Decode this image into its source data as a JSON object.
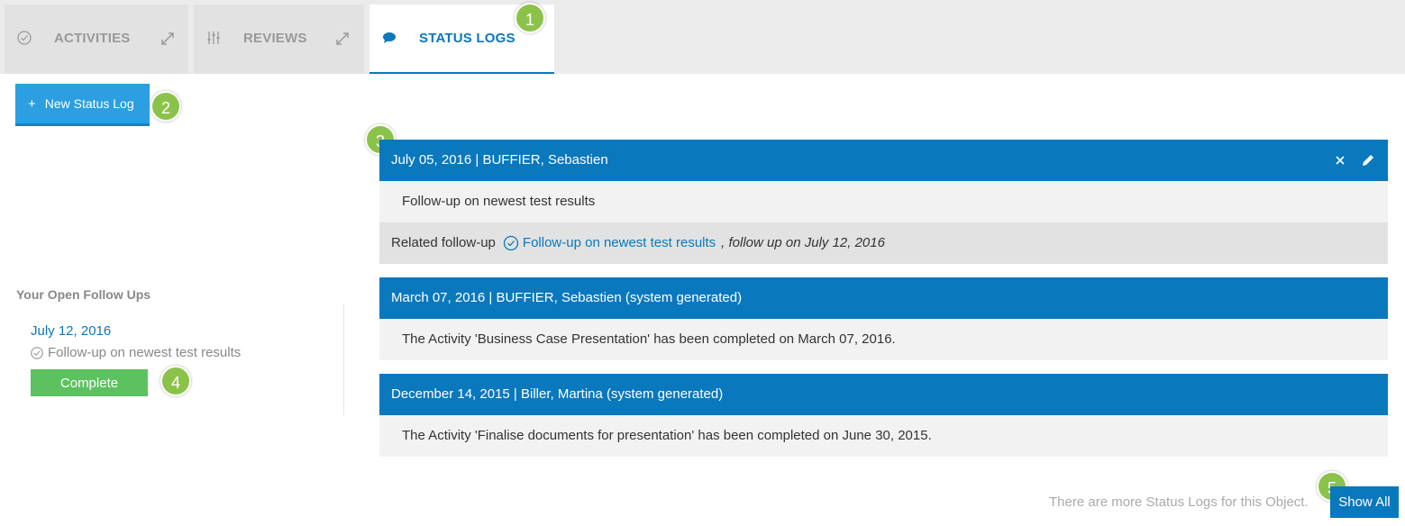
{
  "tabs": [
    {
      "label": "ACTIVITIES",
      "icon": "check-circle-icon",
      "active": false
    },
    {
      "label": "REVIEWS",
      "icon": "sliders-icon",
      "active": false
    },
    {
      "label": "STATUS LOGS",
      "icon": "speech-bubble-icon",
      "active": true
    }
  ],
  "badges": [
    "1",
    "2",
    "3",
    "4",
    "5"
  ],
  "toolbar": {
    "new_status_log_label": "New Status Log",
    "plus": "+"
  },
  "followups": {
    "title": "Your Open Follow Ups",
    "items": [
      {
        "date": "July 12, 2016",
        "label": "Follow-up on newest test results",
        "complete_label": "Complete"
      }
    ]
  },
  "logs": [
    {
      "header": "July 05, 2016 | BUFFIER, Sebastien",
      "body": "Follow-up on newest test results",
      "related_label": "Related follow-up",
      "related_link": "Follow-up on newest test results",
      "related_suffix": ", follow up on July 12, 2016",
      "has_actions": true
    },
    {
      "header": "March 07, 2016 | BUFFIER, Sebastien (system generated)",
      "body": "The Activity 'Business Case Presentation' has been completed on March 07, 2016."
    },
    {
      "header": "December 14, 2015 | Biller, Martina (system generated)",
      "body": "The Activity 'Finalise documents for presentation' has been completed on June 30, 2015."
    }
  ],
  "footer": {
    "more_text": "There are more Status Logs for this Object.",
    "show_all_label": "Show All"
  },
  "colors": {
    "primary": "#0a78bd",
    "button_blue": "#2b9fe0",
    "complete_green": "#5cc25f",
    "badge_green": "#8bc34a"
  }
}
